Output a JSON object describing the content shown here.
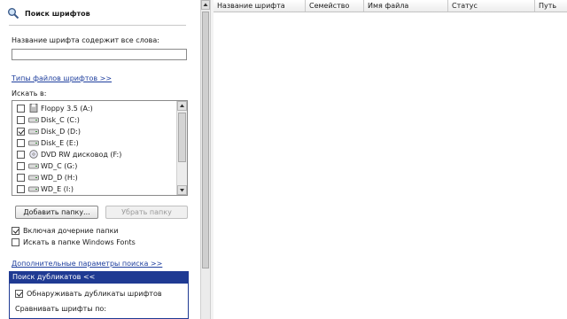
{
  "panel": {
    "title": "Поиск шрифтов",
    "contains_label": "Название шрифта содержит все слова:",
    "contains_value": "",
    "filetypes_link": "Типы файлов шрифтов >>",
    "search_in_label": "Искать в:",
    "drives": [
      {
        "label": "Floppy 3.5 (A:)",
        "checked": false,
        "icon": "floppy-icon"
      },
      {
        "label": "Disk_C (C:)",
        "checked": false,
        "icon": "hard-drive-icon"
      },
      {
        "label": "Disk_D (D:)",
        "checked": true,
        "icon": "hard-drive-icon"
      },
      {
        "label": "Disk_E (E:)",
        "checked": false,
        "icon": "hard-drive-icon"
      },
      {
        "label": "DVD RW дисковод (F:)",
        "checked": false,
        "icon": "dvd-drive-icon"
      },
      {
        "label": "WD_C (G:)",
        "checked": false,
        "icon": "hard-drive-icon"
      },
      {
        "label": "WD_D (H:)",
        "checked": false,
        "icon": "hard-drive-icon"
      },
      {
        "label": "WD_E (I:)",
        "checked": false,
        "icon": "hard-drive-icon"
      }
    ],
    "add_folder_button": "Добавить папку...",
    "remove_folder_button": "Убрать папку",
    "include_subfolders": {
      "label": "Включая дочерние папки",
      "checked": true
    },
    "search_windows_fonts": {
      "label": "Искать в папке Windows Fonts",
      "checked": false
    },
    "advanced_link": "Дополнительные параметры поиска >>",
    "duplicates_header": "Поиск дубликатов <<",
    "detect_duplicates": {
      "label": "Обнаруживать дубликаты шрифтов",
      "checked": true
    },
    "compare_label": "Сравнивать шрифты по:"
  },
  "results": {
    "columns": [
      "Название шрифта",
      "Семейство",
      "Имя файла",
      "Статус",
      "Путь"
    ]
  },
  "colors": {
    "accent": "#1f3a93",
    "link": "#1f3f9e"
  }
}
